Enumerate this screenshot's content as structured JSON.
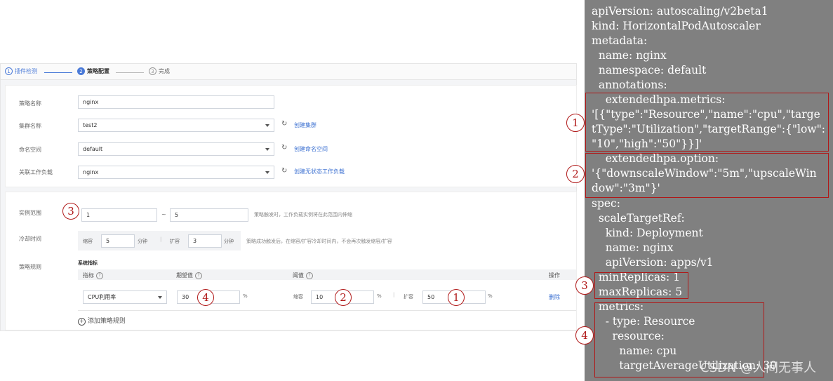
{
  "steps": [
    {
      "num": "1",
      "label": "插件检测"
    },
    {
      "num": "2",
      "label": "策略配置"
    },
    {
      "num": "3",
      "label": "完成"
    }
  ],
  "form": {
    "policy_name_label": "策略名称",
    "policy_name_value": "nginx",
    "cluster_label": "集群名称",
    "cluster_value": "test2",
    "cluster_link": "创建集群",
    "namespace_label": "命名空间",
    "namespace_value": "default",
    "namespace_link": "创建命名空间",
    "workload_label": "关联工作负载",
    "workload_value": "nginx",
    "workload_link": "创建无状态工作负载"
  },
  "scaling": {
    "instance_range_label": "实例范围",
    "min_value": "1",
    "range_sep": "~",
    "max_value": "5",
    "range_hint": "策略触发时，工作负载实例将在此范围内伸缩",
    "cooldown_label": "冷却时间",
    "scale_in_label": "缩容",
    "scale_in_value": "5",
    "scale_in_unit": "分钟",
    "scale_out_label": "扩容",
    "scale_out_value": "3",
    "scale_out_unit": "分钟",
    "cooldown_hint": "策略成功触发后，在缩容/扩容冷却时间内，不会再次触发缩容/扩容",
    "rules_label": "策略规则",
    "system_metrics_label": "系统指标",
    "col_metric": "指标",
    "col_expected": "期望值",
    "col_threshold": "阈值",
    "col_action": "操作",
    "row_metric": "CPU利用率",
    "row_expected": "30",
    "row_expected_unit": "%",
    "row_scale_in_label": "缩容",
    "row_scale_in": "10",
    "row_scale_in_unit": "%",
    "row_scale_out_label": "扩容",
    "row_scale_out": "50",
    "row_scale_out_unit": "%",
    "row_delete": "删除",
    "add_rule": "添加策略规则"
  },
  "callouts": {
    "c1": "1",
    "c2": "2",
    "c3": "3",
    "c4": "4"
  },
  "yaml_lines": [
    "apiVersion: autoscaling/v2beta1",
    "kind: HorizontalPodAutoscaler",
    "metadata:",
    "  name: nginx",
    "  namespace: default",
    "  annotations:",
    "    extendedhpa.metrics:",
    "'[{\"type\":\"Resource\",\"name\":\"cpu\",\"targe",
    "tType\":\"Utilization\",\"targetRange\":{\"low\":",
    "\"10\",\"high\":\"50\"}}]'",
    "    extendedhpa.option:",
    "'{\"downscaleWindow\":\"5m\",\"upscaleWin",
    "dow\":\"3m\"}'",
    "spec:",
    "  scaleTargetRef:",
    "    kind: Deployment",
    "    name: nginx",
    "    apiVersion: apps/v1",
    "  minReplicas: 1",
    "  maxReplicas: 5",
    "  metrics:",
    "    - type: Resource",
    "      resource:",
    "        name: cpu",
    "        targetAverageUtilization: 30"
  ],
  "watermark": "CSDN @人间无事人",
  "colors": {
    "accent": "#4a7ad8",
    "callout": "#b01818",
    "yaml_bg": "#808080"
  }
}
